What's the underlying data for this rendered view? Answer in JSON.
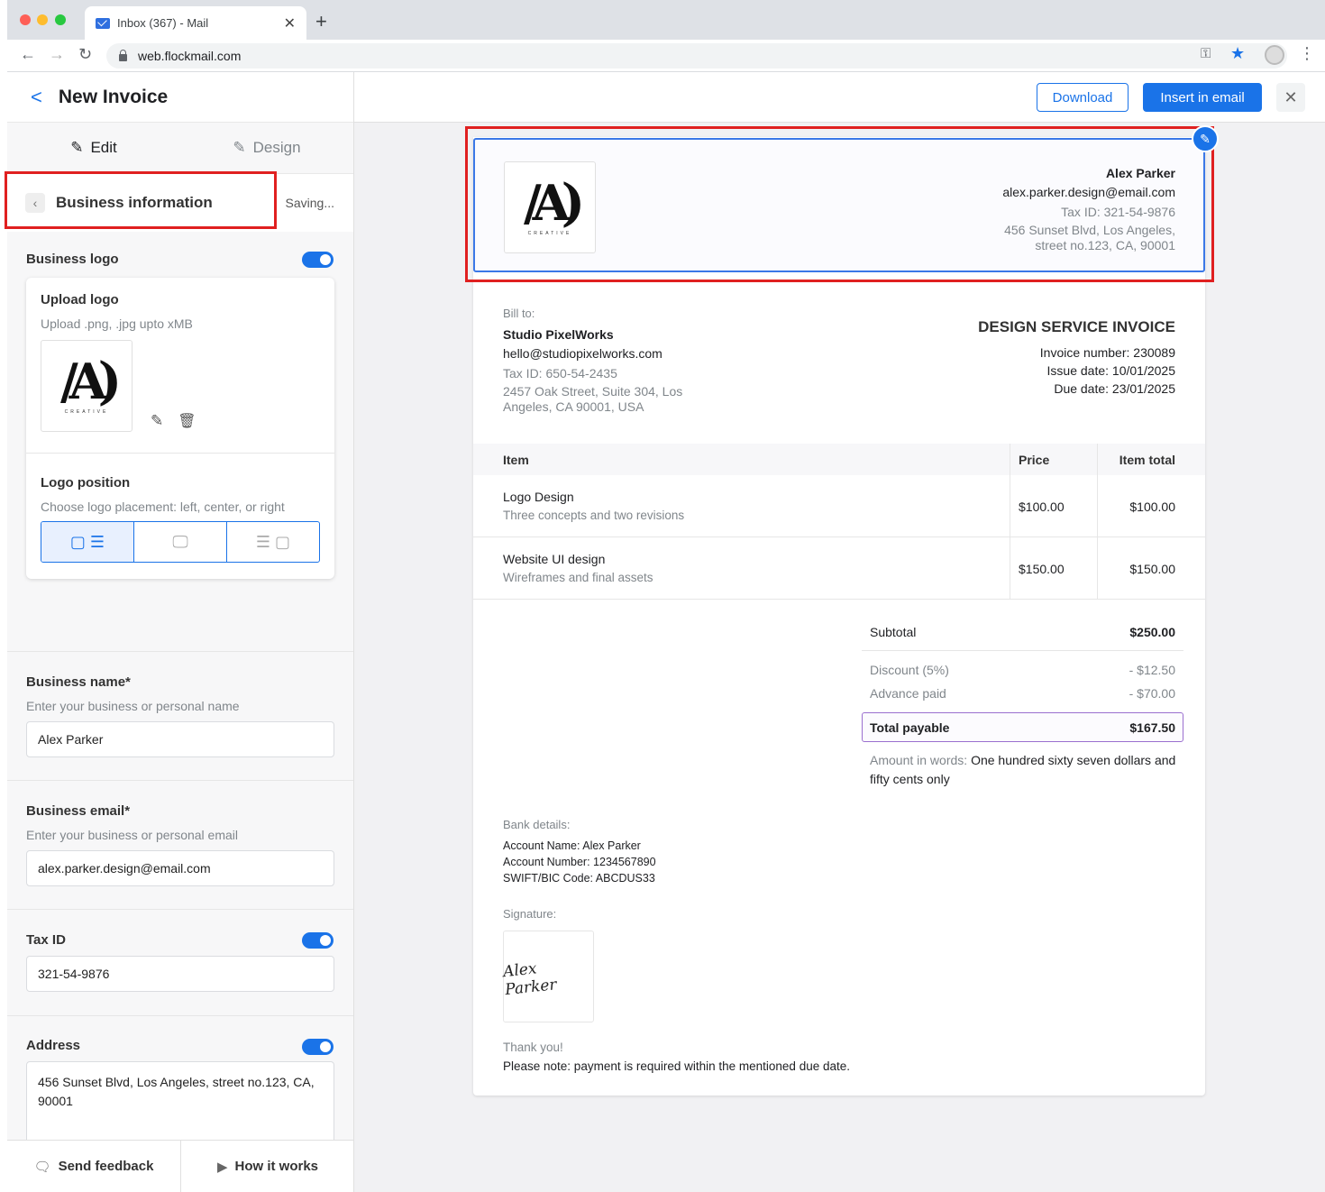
{
  "browser": {
    "tab_title": "Inbox (367) - Mail",
    "url": "web.flockmail.com"
  },
  "panel": {
    "title": "New Invoice",
    "tab_edit": "Edit",
    "tab_design": "Design",
    "section_label": "Business information",
    "saving_text": "Saving...",
    "logo_label": "Business logo",
    "upload_title": "Upload logo",
    "upload_hint": "Upload .png, .jpg upto xMB",
    "logo_text": "CREATIVE",
    "position_title": "Logo position",
    "position_hint": "Choose logo placement: left, center, or right",
    "name_label": "Business name*",
    "name_hint": "Enter your business or personal name",
    "name_value": "Alex Parker",
    "email_label": "Business email*",
    "email_hint": "Enter your business or personal email",
    "email_value": "alex.parker.design@email.com",
    "tax_label": "Tax ID",
    "tax_value": "321-54-9876",
    "address_label": "Address",
    "address_value": "456 Sunset Blvd, Los Angeles, street no.123, CA, 90001",
    "feedback": "Send feedback",
    "how_it_works": "How it works"
  },
  "actions": {
    "download": "Download",
    "insert": "Insert in email"
  },
  "invoice": {
    "biz_name": "Alex Parker",
    "biz_email": "alex.parker.design@email.com",
    "biz_tax": "Tax ID: 321-54-9876",
    "biz_addr1": "456 Sunset Blvd, Los Angeles,",
    "biz_addr2": "street no.123, CA, 90001",
    "bill_to_label": "Bill to:",
    "client_name": "Studio PixelWorks",
    "client_email": "hello@studiopixelworks.com",
    "client_tax": "Tax ID: 650-54-2435",
    "client_addr1": "2457 Oak Street, Suite 304, Los",
    "client_addr2": "Angeles, CA 90001, USA",
    "doc_title": "DESIGN SERVICE INVOICE",
    "number": "Invoice number: 230089",
    "issue": "Issue date: 10/01/2025",
    "due": "Due date: 23/01/2025",
    "col_item": "Item",
    "col_price": "Price",
    "col_total": "Item total",
    "items": [
      {
        "name": "Logo Design",
        "desc": "Three concepts and two revisions",
        "price": "$100.00",
        "total": "$100.00"
      },
      {
        "name": "Website UI design",
        "desc": "Wireframes and final assets",
        "price": "$150.00",
        "total": "$150.00"
      }
    ],
    "subtotal_label": "Subtotal",
    "subtotal": "$250.00",
    "discount_label": "Discount (5%)",
    "discount": "- $12.50",
    "advance_label": "Advance paid",
    "advance": "- $70.00",
    "payable_label": "Total payable",
    "payable": "$167.50",
    "words_label": "Amount in words:",
    "words_1": "One hundred sixty seven dollars and",
    "words_2": "fifty cents only",
    "bank_label": "Bank details:",
    "bank_1": "Account Name: Alex Parker",
    "bank_2": "Account Number: 1234567890",
    "bank_3": "SWIFT/BIC Code: ABCDUS33",
    "sig_label": "Signature:",
    "sig_text": "Alex Parker",
    "thanks": "Thank you!",
    "note": "Please note: payment is required within the mentioned due date."
  }
}
